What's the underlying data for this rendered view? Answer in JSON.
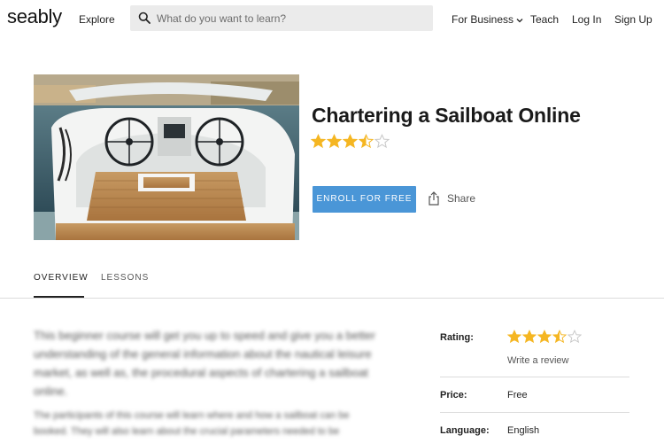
{
  "header": {
    "logo": "seably",
    "explore": "Explore",
    "search_placeholder": "What do you want to learn?",
    "nav": {
      "business": "For Business",
      "teach": "Teach",
      "login": "Log In",
      "signup": "Sign Up"
    }
  },
  "course": {
    "title": "Chartering a Sailboat Online",
    "rating": 3.5,
    "rating_max": 5,
    "enroll_label": "ENROLL FOR FREE",
    "share_label": "Share"
  },
  "tabs": [
    {
      "label": "OVERVIEW",
      "active": true
    },
    {
      "label": "LESSONS",
      "active": false
    }
  ],
  "description": {
    "paragraphs": [
      "This beginner course will get you up to speed and give you a better understanding of the general information about the nautical leisure market, as well as, the procedural aspects of chartering a sailboat online.",
      "The participants of this course will learn where and how a sailboat can be booked. They will also learn about the crucial parameters needed to be"
    ]
  },
  "info": {
    "rating_label": "Rating:",
    "write_review": "Write a review",
    "price_label": "Price:",
    "price_value": "Free",
    "language_label": "Language:",
    "language_value": "English"
  },
  "colors": {
    "accent": "#4a96d7",
    "star_filled": "#f5b622",
    "star_empty": "#c8c8c8"
  }
}
